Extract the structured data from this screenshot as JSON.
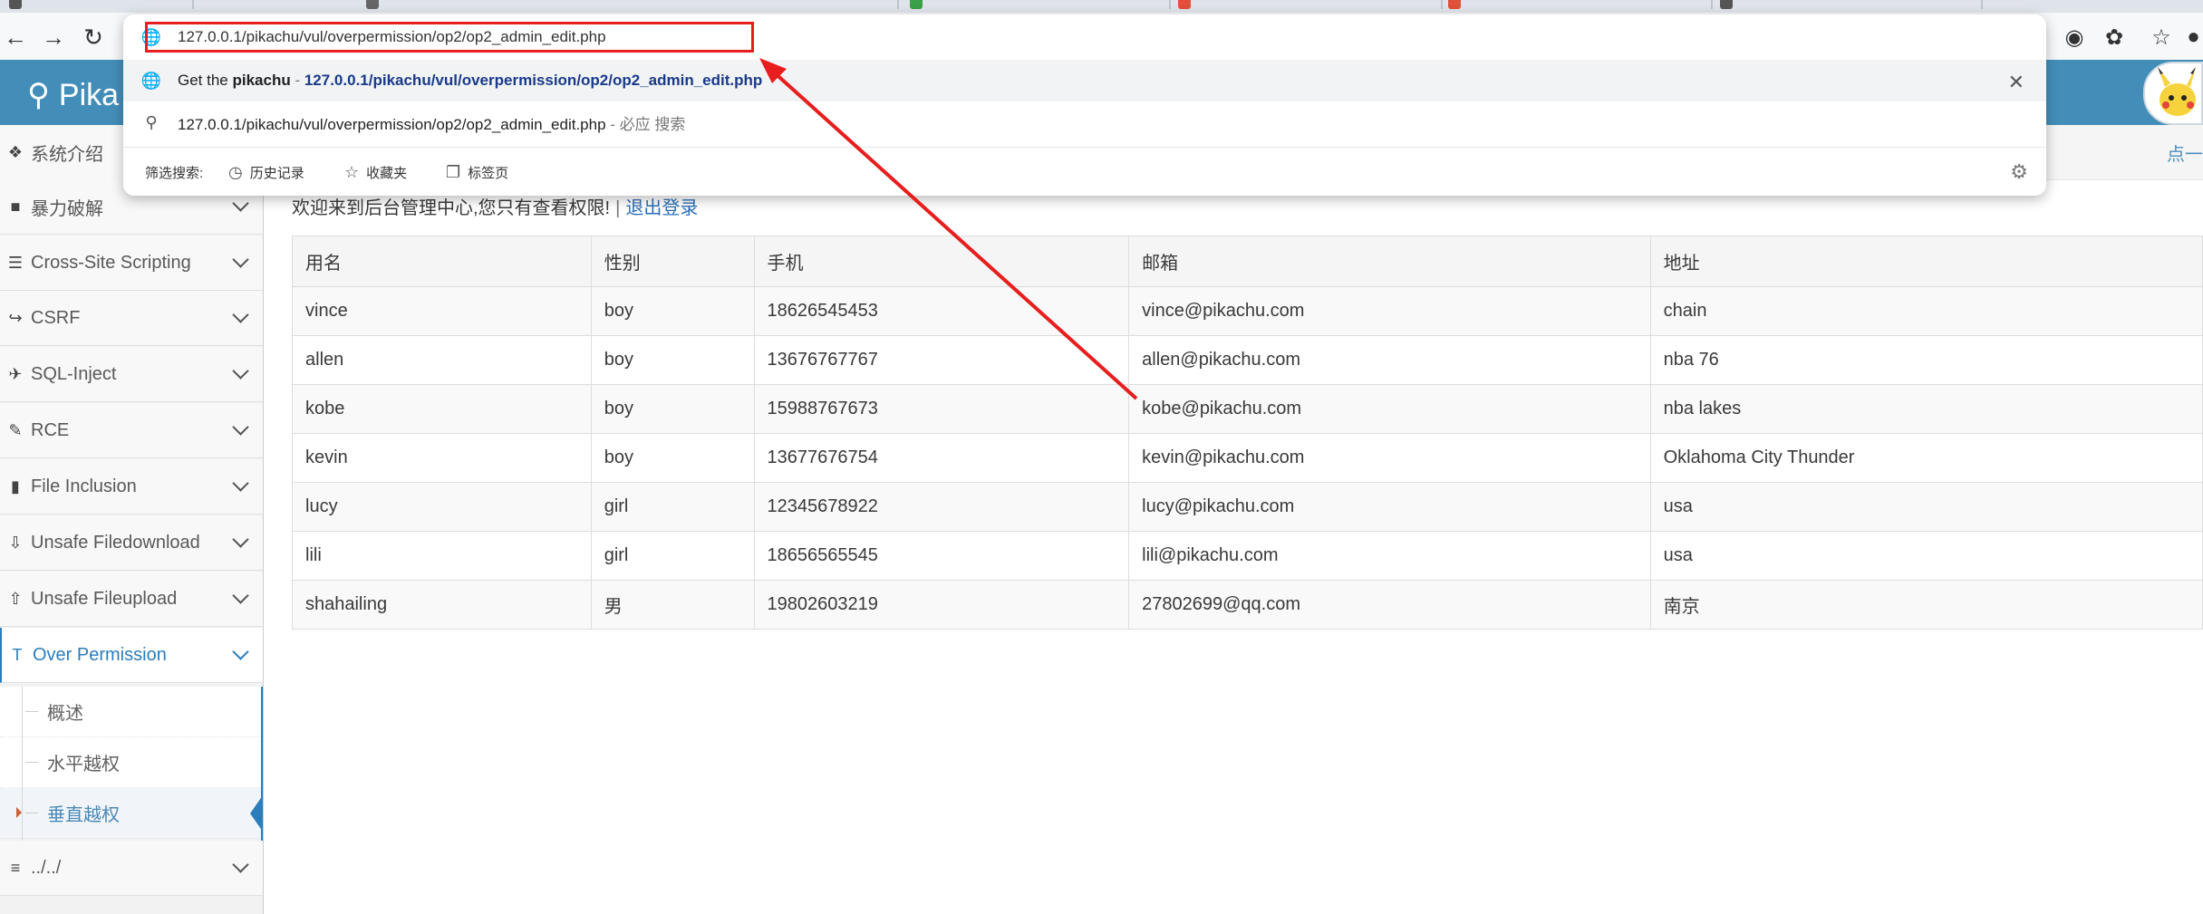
{
  "browser": {
    "address_url": "127.0.0.1/pikachu/vul/overpermission/op2/op2_admin_edit.php",
    "suggestion_prefix": "Get the ",
    "suggestion_site": "pikachu",
    "suggestion_sep": " - ",
    "suggestion_url": "127.0.0.1/pikachu/vul/overpermission/op2/op2_admin_edit.php",
    "search_query": "127.0.0.1/pikachu/vul/overpermission/op2/op2_admin_edit.php",
    "search_engine_suffix": " - 必应 搜索",
    "filter_label": "筛选搜索:",
    "filters": [
      "历史记录",
      "收藏夹",
      "标签页"
    ]
  },
  "site": {
    "logo_text": "Pika",
    "top_right_link": "点一"
  },
  "sidebar": {
    "items": [
      {
        "label": "系统介绍",
        "icon": "tags-icon"
      },
      {
        "label": "暴力破解",
        "icon": "lock-icon"
      },
      {
        "label": "Cross-Site Scripting",
        "icon": "sitemap-icon"
      },
      {
        "label": "CSRF",
        "icon": "share-icon"
      },
      {
        "label": "SQL-Inject",
        "icon": "plane-icon"
      },
      {
        "label": "RCE",
        "icon": "pencil-icon"
      },
      {
        "label": "File Inclusion",
        "icon": "file-icon"
      },
      {
        "label": "Unsafe Filedownload",
        "icon": "download-icon"
      },
      {
        "label": "Unsafe Fileupload",
        "icon": "upload-icon"
      },
      {
        "label": "Over Permission",
        "icon": "text-height-icon"
      }
    ],
    "sub_items": [
      "概述",
      "水平越权",
      "垂直越权"
    ],
    "after_items": [
      {
        "label": "../../",
        "icon": "align-left-icon"
      }
    ]
  },
  "main": {
    "welcome_text": "欢迎来到后台管理中心,您只有查看权限!",
    "separator": "|",
    "logout_label": "退出登录",
    "table": {
      "headers": [
        "用名",
        "性别",
        "手机",
        "邮箱",
        "地址"
      ],
      "rows": [
        [
          "vince",
          "boy",
          "18626545453",
          "vince@pikachu.com",
          "chain"
        ],
        [
          "allen",
          "boy",
          "13676767767",
          "allen@pikachu.com",
          "nba 76"
        ],
        [
          "kobe",
          "boy",
          "15988767673",
          "kobe@pikachu.com",
          "nba lakes"
        ],
        [
          "kevin",
          "boy",
          "13677676754",
          "kevin@pikachu.com",
          "Oklahoma City Thunder"
        ],
        [
          "lucy",
          "girl",
          "12345678922",
          "lucy@pikachu.com",
          "usa"
        ],
        [
          "lili",
          "girl",
          "18656565545",
          "lili@pikachu.com",
          "usa"
        ],
        [
          "shahailing",
          "男",
          "19802603219",
          "27802699@qq.com",
          "南京"
        ]
      ]
    }
  },
  "colors": {
    "header": "#438eb9",
    "accent": "#2b7dbc",
    "annotation": "#e81d1d"
  }
}
